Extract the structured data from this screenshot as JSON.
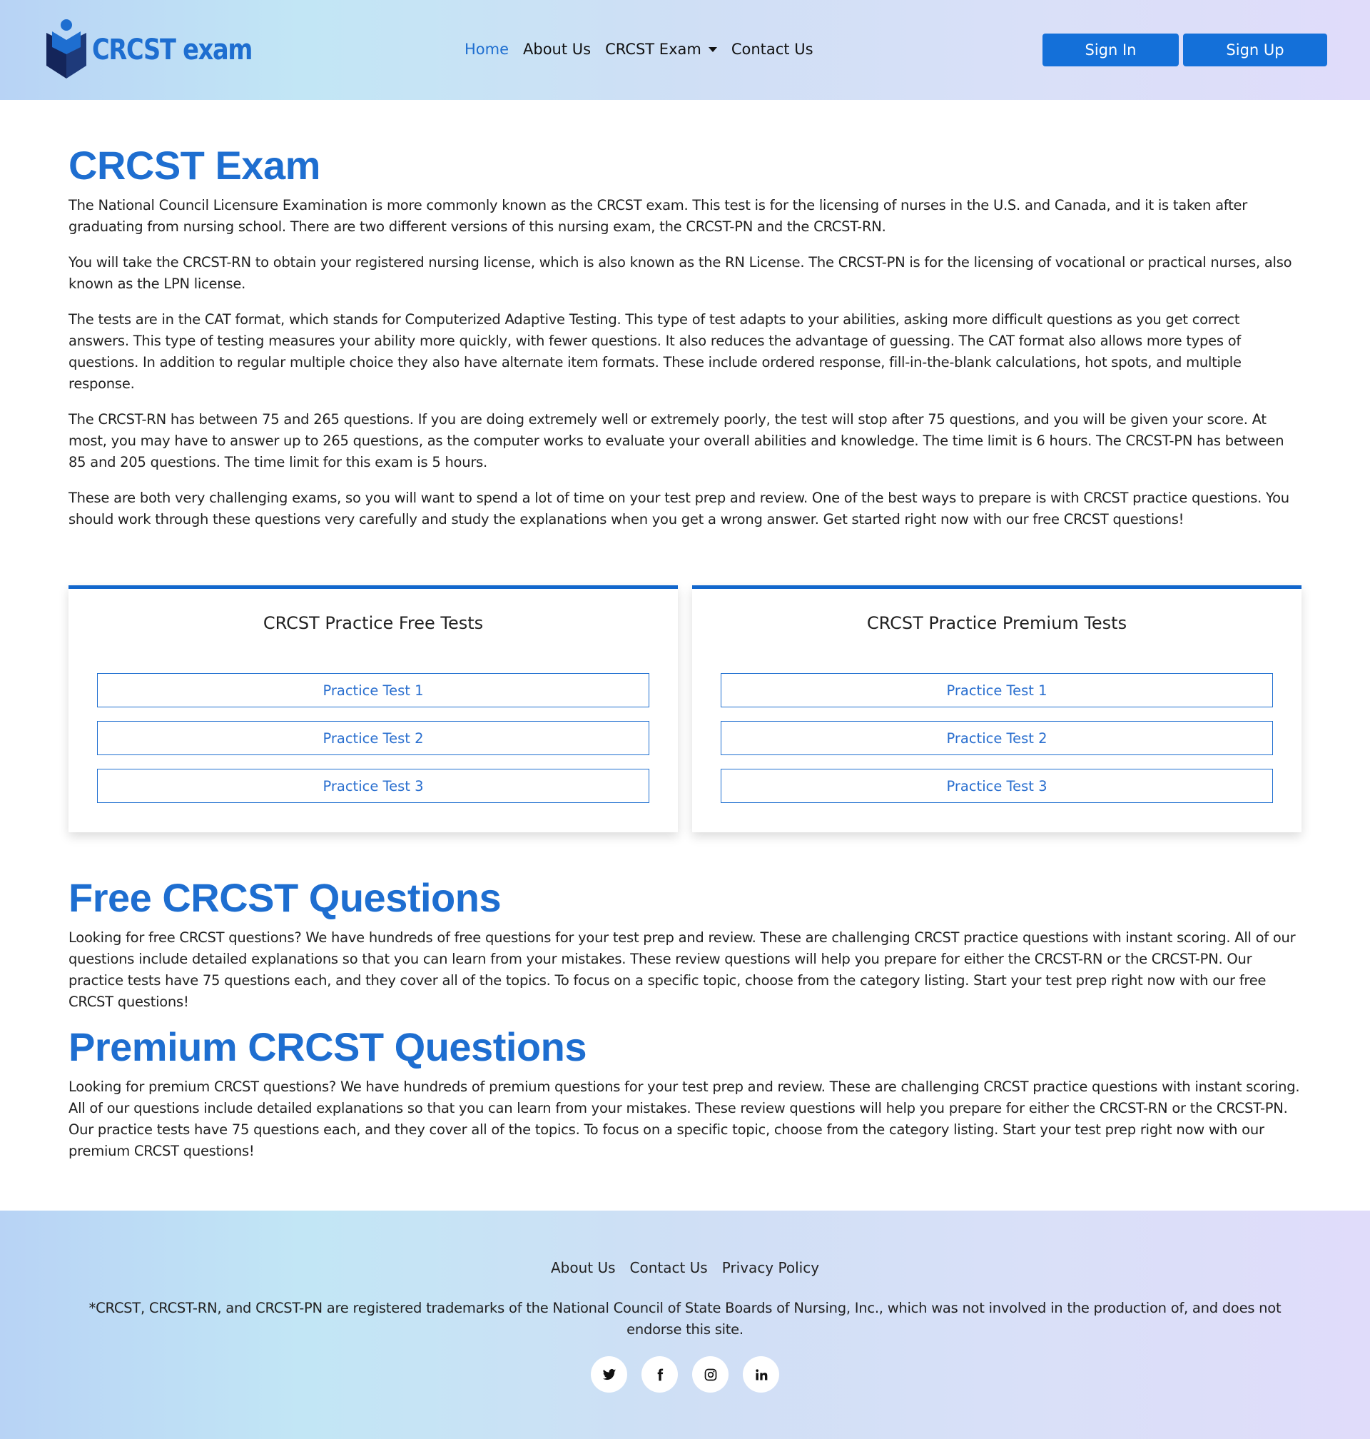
{
  "header": {
    "logo_text": "CRCST exam",
    "nav": [
      {
        "label": "Home",
        "active": true
      },
      {
        "label": "About Us"
      },
      {
        "label": "CRCST Exam",
        "dropdown": true
      },
      {
        "label": "Contact Us"
      }
    ],
    "sign_in": "Sign In",
    "sign_up": "Sign Up"
  },
  "intro": {
    "title": "CRCST Exam",
    "paragraphs": [
      "The National Council Licensure Examination is more commonly known as the CRCST exam. This test is for the licensing of nurses in the U.S. and Canada, and it is taken after graduating from nursing school. There are two different versions of this nursing exam, the CRCST-PN and the CRCST-RN.",
      "You will take the CRCST-RN to obtain your registered nursing license, which is also known as the RN License. The CRCST-PN is for the licensing of vocational or practical nurses, also known as the LPN license.",
      "The tests are in the CAT format, which stands for Computerized Adaptive Testing. This type of test adapts to your abilities, asking more difficult questions as you get correct answers. This type of testing measures your ability more quickly, with fewer questions. It also reduces the advantage of guessing. The CAT format also allows more types of questions. In addition to regular multiple choice they also have alternate item formats. These include ordered response, fill-in-the-blank calculations, hot spots, and multiple response.",
      "The CRCST-RN has between 75 and 265 questions. If you are doing extremely well or extremely poorly, the test will stop after 75 questions, and you will be given your score. At most, you may have to answer up to 265 questions, as the computer works to evaluate your overall abilities and knowledge. The time limit is 6 hours. The CRCST-PN has between 85 and 205 questions. The time limit for this exam is 5 hours.",
      "These are both very challenging exams, so you will want to spend a lot of time on your test prep and review. One of the best ways to prepare is with CRCST practice questions. You should work through these questions very carefully and study the explanations when you get a wrong answer. Get started right now with our free CRCST questions!"
    ]
  },
  "cards": {
    "free": {
      "title": "CRCST Practice Free Tests",
      "buttons": [
        "Practice Test 1",
        "Practice Test 2",
        "Practice Test 3"
      ]
    },
    "premium": {
      "title": "CRCST Practice Premium Tests",
      "buttons": [
        "Practice Test 1",
        "Practice Test 2",
        "Practice Test 3"
      ]
    }
  },
  "free_section": {
    "title": "Free CRCST Questions",
    "text": "Looking for free CRCST questions? We have hundreds of free questions for your test prep and review. These are challenging CRCST practice questions with instant scoring. All of our questions include detailed explanations so that you can learn from your mistakes. These review questions will help you prepare for either the CRCST-RN or the CRCST-PN. Our practice tests have 75 questions each, and they cover all of the topics. To focus on a specific topic, choose from the category listing. Start your test prep right now with our free CRCST questions!"
  },
  "premium_section": {
    "title": "Premium CRCST Questions",
    "text": "Looking for premium CRCST questions? We have hundreds of premium questions for your test prep and review. These are challenging CRCST practice questions with instant scoring. All of our questions include detailed explanations so that you can learn from your mistakes. These review questions will help you prepare for either the CRCST-RN or the CRCST-PN. Our practice tests have 75 questions each, and they cover all of the topics. To focus on a specific topic, choose from the category listing. Start your test prep right now with our premium CRCST questions!"
  },
  "footer": {
    "links": [
      "About Us",
      "Contact Us",
      "Privacy Policy"
    ],
    "disclaimer": "*CRCST, CRCST-RN, and CRCST-PN are registered trademarks of the National Council of State Boards of Nursing, Inc., which was not involved in the production of, and does not endorse this site.",
    "socials": [
      "twitter-icon",
      "facebook-icon",
      "instagram-icon",
      "linkedin-icon"
    ]
  },
  "colors": {
    "brand_blue": "#1e6ed0",
    "button_blue": "#1470d9",
    "logo_dark": "#14255a"
  }
}
